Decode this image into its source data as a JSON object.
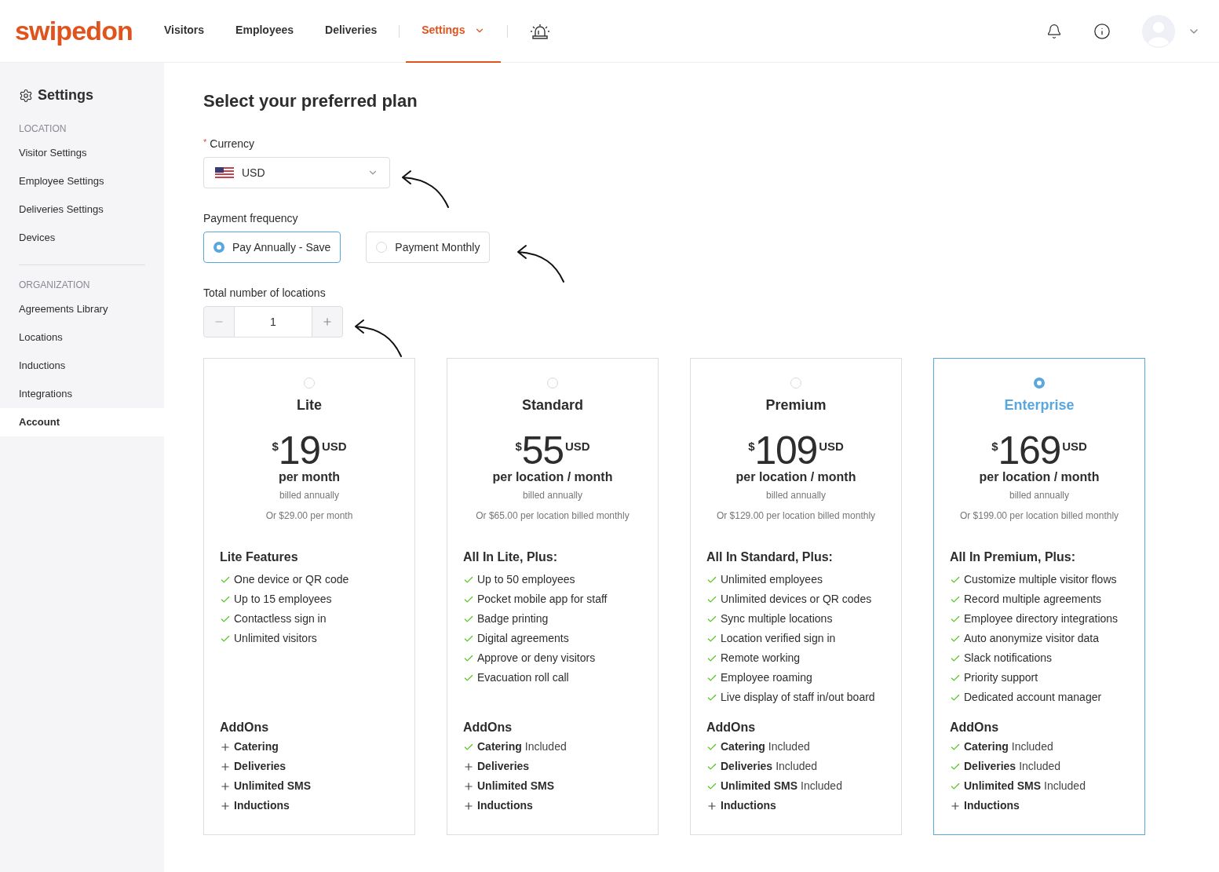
{
  "nav": {
    "logo": "swipedon",
    "items": [
      {
        "label": "Visitors",
        "selected": false,
        "dropdown": false
      },
      {
        "label": "Employees",
        "selected": false,
        "dropdown": false
      },
      {
        "label": "Deliveries",
        "selected": false,
        "dropdown": false
      },
      {
        "label": "Settings",
        "selected": true,
        "dropdown": true
      }
    ]
  },
  "sidebar": {
    "title": "Settings",
    "sections": [
      {
        "heading": "LOCATION",
        "items": [
          {
            "label": "Visitor Settings",
            "selected": false
          },
          {
            "label": "Employee Settings",
            "selected": false
          },
          {
            "label": "Deliveries Settings",
            "selected": false
          },
          {
            "label": "Devices",
            "selected": false
          }
        ]
      },
      {
        "heading": "ORGANIZATION",
        "items": [
          {
            "label": "Agreements Library",
            "selected": false
          },
          {
            "label": "Locations",
            "selected": false
          },
          {
            "label": "Inductions",
            "selected": false
          },
          {
            "label": "Integrations",
            "selected": false
          },
          {
            "label": "Account",
            "selected": true
          }
        ]
      }
    ]
  },
  "page": {
    "title": "Select your preferred plan",
    "currency": {
      "label": "Currency",
      "required_mark": "*",
      "value": "USD"
    },
    "frequency": {
      "label": "Payment frequency",
      "options": [
        {
          "label": "Pay Annually - Save",
          "selected": true
        },
        {
          "label": "Payment Monthly",
          "selected": false
        }
      ]
    },
    "locations": {
      "label": "Total number of locations",
      "value": "1"
    }
  },
  "plans": [
    {
      "name": "Lite",
      "selected": false,
      "symbol": "$",
      "price": "19",
      "currency": "USD",
      "period": "per month",
      "billing": "billed annually",
      "alt": "Or $29.00 per month",
      "features_title": "Lite Features",
      "features": [
        "One device or QR code",
        "Up to 15 employees",
        "Contactless sign in",
        "Unlimited visitors"
      ],
      "addons_title": "AddOns",
      "addons": [
        {
          "name": "Catering",
          "included": false
        },
        {
          "name": "Deliveries",
          "included": false
        },
        {
          "name": "Unlimited SMS",
          "included": false
        },
        {
          "name": "Inductions",
          "included": false
        }
      ]
    },
    {
      "name": "Standard",
      "selected": false,
      "symbol": "$",
      "price": "55",
      "currency": "USD",
      "period": "per location / month",
      "billing": "billed annually",
      "alt": "Or $65.00 per location billed monthly",
      "features_title": "All In Lite, Plus:",
      "features": [
        "Up to 50 employees",
        "Pocket mobile app for staff",
        "Badge printing",
        "Digital agreements",
        "Approve or deny visitors",
        "Evacuation roll call"
      ],
      "addons_title": "AddOns",
      "addons": [
        {
          "name": "Catering",
          "included": true,
          "note": "Included"
        },
        {
          "name": "Deliveries",
          "included": false
        },
        {
          "name": "Unlimited SMS",
          "included": false
        },
        {
          "name": "Inductions",
          "included": false
        }
      ]
    },
    {
      "name": "Premium",
      "selected": false,
      "symbol": "$",
      "price": "109",
      "currency": "USD",
      "period": "per location / month",
      "billing": "billed annually",
      "alt": "Or $129.00 per location billed monthly",
      "features_title": "All In Standard, Plus:",
      "features": [
        "Unlimited employees",
        "Unlimited devices or QR codes",
        "Sync multiple locations",
        "Location verified sign in",
        "Remote working",
        "Employee roaming",
        "Live display of staff in/out board"
      ],
      "addons_title": "AddOns",
      "addons": [
        {
          "name": "Catering",
          "included": true,
          "note": "Included"
        },
        {
          "name": "Deliveries",
          "included": true,
          "note": "Included"
        },
        {
          "name": "Unlimited SMS",
          "included": true,
          "note": "Included"
        },
        {
          "name": "Inductions",
          "included": false
        }
      ]
    },
    {
      "name": "Enterprise",
      "selected": true,
      "symbol": "$",
      "price": "169",
      "currency": "USD",
      "period": "per location / month",
      "billing": "billed annually",
      "alt": "Or $199.00 per location billed monthly",
      "features_title": "All In Premium, Plus:",
      "features": [
        "Customize multiple visitor flows",
        "Record multiple agreements",
        "Employee directory integrations",
        "Auto anonymize visitor data",
        "Slack notifications",
        "Priority support",
        "Dedicated account manager"
      ],
      "addons_title": "AddOns",
      "addons": [
        {
          "name": "Catering",
          "included": true,
          "note": "Included"
        },
        {
          "name": "Deliveries",
          "included": true,
          "note": "Included"
        },
        {
          "name": "Unlimited SMS",
          "included": true,
          "note": "Included"
        },
        {
          "name": "Inductions",
          "included": false
        }
      ]
    }
  ]
}
